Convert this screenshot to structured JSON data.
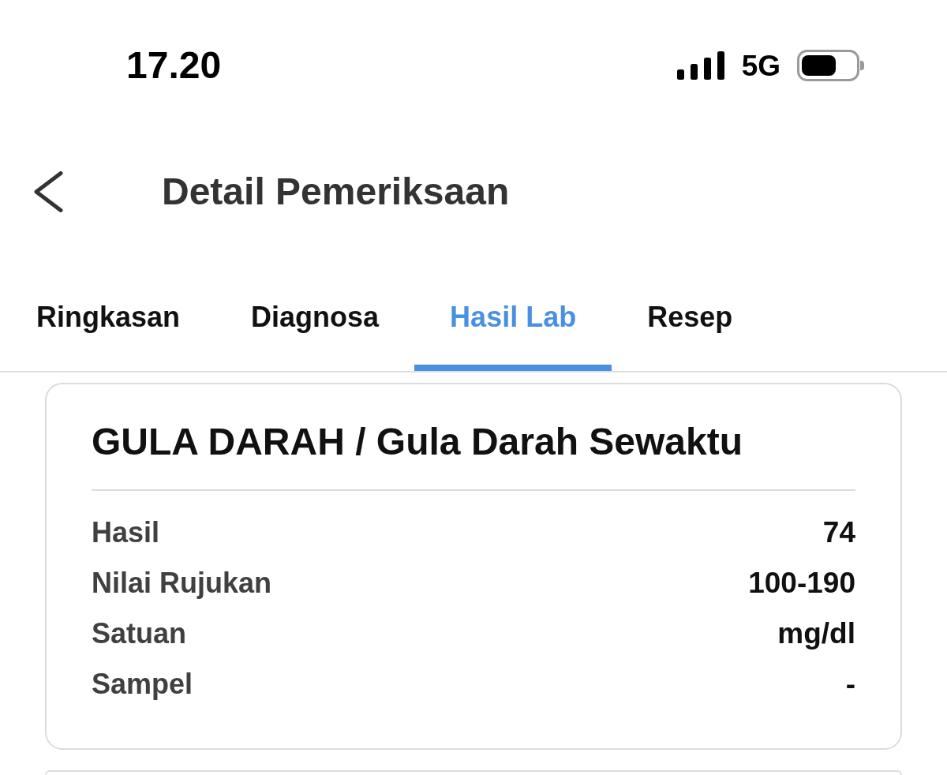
{
  "status_bar": {
    "time": "17.20",
    "network": "5G"
  },
  "header": {
    "title": "Detail Pemeriksaan"
  },
  "tabs": [
    {
      "label": "Ringkasan",
      "selected": false
    },
    {
      "label": "Diagnosa",
      "selected": false
    },
    {
      "label": "Hasil Lab",
      "selected": true
    },
    {
      "label": "Resep",
      "selected": false
    }
  ],
  "lab_results": [
    {
      "title": "GULA DARAH / Gula Darah Sewaktu",
      "rows": [
        {
          "label": "Hasil",
          "value": "74"
        },
        {
          "label": "Nilai Rujukan",
          "value": "100-190"
        },
        {
          "label": "Satuan",
          "value": "mg/dl"
        },
        {
          "label": "Sampel",
          "value": "-"
        }
      ]
    }
  ]
}
